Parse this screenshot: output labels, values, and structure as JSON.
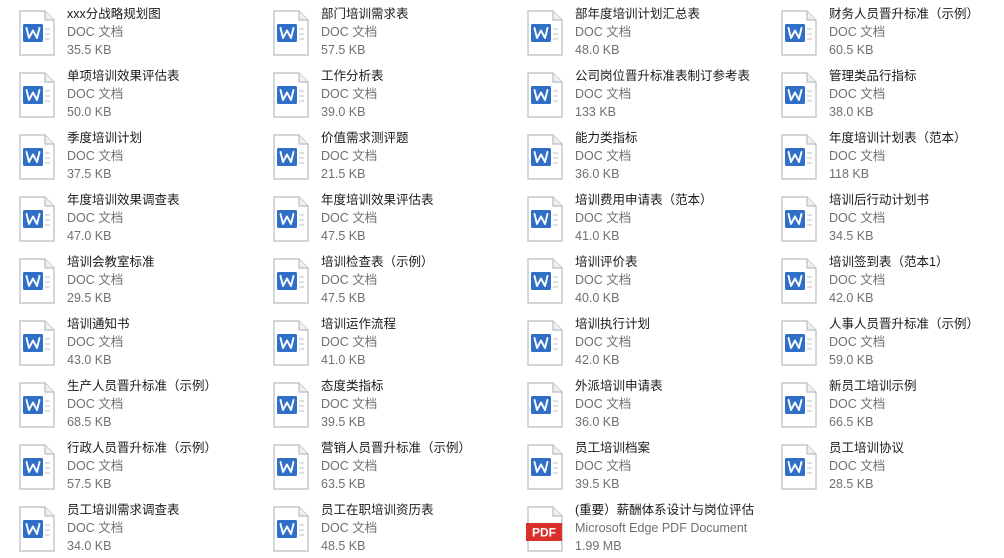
{
  "files": [
    {
      "name": "xxx分战略规划图",
      "type": "DOC 文档",
      "size": "35.5 KB",
      "icon": "word-doc-icon"
    },
    {
      "name": "部门培训需求表",
      "type": "DOC 文档",
      "size": "57.5 KB",
      "icon": "word-doc-icon"
    },
    {
      "name": "部年度培训计划汇总表",
      "type": "DOC 文档",
      "size": "48.0 KB",
      "icon": "word-doc-icon"
    },
    {
      "name": "财务人员晋升标准（示例）",
      "type": "DOC 文档",
      "size": "60.5 KB",
      "icon": "word-doc-icon"
    },
    {
      "name": "单项培训效果评估表",
      "type": "DOC 文档",
      "size": "50.0 KB",
      "icon": "word-doc-icon"
    },
    {
      "name": "工作分析表",
      "type": "DOC 文档",
      "size": "39.0 KB",
      "icon": "word-doc-icon"
    },
    {
      "name": "公司岗位晋升标准表制订参考表",
      "type": "DOC 文档",
      "size": "133 KB",
      "icon": "word-doc-icon"
    },
    {
      "name": "管理类品行指标",
      "type": "DOC 文档",
      "size": "38.0 KB",
      "icon": "word-doc-icon"
    },
    {
      "name": "季度培训计划",
      "type": "DOC 文档",
      "size": "37.5 KB",
      "icon": "word-doc-icon"
    },
    {
      "name": "价值需求测评题",
      "type": "DOC 文档",
      "size": "21.5 KB",
      "icon": "word-doc-icon"
    },
    {
      "name": "能力类指标",
      "type": "DOC 文档",
      "size": "36.0 KB",
      "icon": "word-doc-icon"
    },
    {
      "name": "年度培训计划表（范本）",
      "type": "DOC 文档",
      "size": "118 KB",
      "icon": "word-doc-icon"
    },
    {
      "name": "年度培训效果调查表",
      "type": "DOC 文档",
      "size": "47.0 KB",
      "icon": "word-doc-icon"
    },
    {
      "name": "年度培训效果评估表",
      "type": "DOC 文档",
      "size": "47.5 KB",
      "icon": "word-doc-icon"
    },
    {
      "name": "培训费用申请表（范本）",
      "type": "DOC 文档",
      "size": "41.0 KB",
      "icon": "word-doc-icon"
    },
    {
      "name": "培训后行动计划书",
      "type": "DOC 文档",
      "size": "34.5 KB",
      "icon": "word-doc-icon"
    },
    {
      "name": "培训会教室标准",
      "type": "DOC 文档",
      "size": "29.5 KB",
      "icon": "word-doc-icon"
    },
    {
      "name": "培训检查表（示例）",
      "type": "DOC 文档",
      "size": "47.5 KB",
      "icon": "word-doc-icon"
    },
    {
      "name": "培训评价表",
      "type": "DOC 文档",
      "size": "40.0 KB",
      "icon": "word-doc-icon"
    },
    {
      "name": "培训签到表（范本1）",
      "type": "DOC 文档",
      "size": "42.0 KB",
      "icon": "word-doc-icon"
    },
    {
      "name": "培训通知书",
      "type": "DOC 文档",
      "size": "43.0 KB",
      "icon": "word-doc-icon"
    },
    {
      "name": "培训运作流程",
      "type": "DOC 文档",
      "size": "41.0 KB",
      "icon": "word-doc-icon"
    },
    {
      "name": "培训执行计划",
      "type": "DOC 文档",
      "size": "42.0 KB",
      "icon": "word-doc-icon"
    },
    {
      "name": "人事人员晋升标准（示例）",
      "type": "DOC 文档",
      "size": "59.0 KB",
      "icon": "word-doc-icon"
    },
    {
      "name": "生产人员晋升标准（示例）",
      "type": "DOC 文档",
      "size": "68.5 KB",
      "icon": "word-doc-icon"
    },
    {
      "name": "态度类指标",
      "type": "DOC 文档",
      "size": "39.5 KB",
      "icon": "word-doc-icon"
    },
    {
      "name": "外派培训申请表",
      "type": "DOC 文档",
      "size": "36.0 KB",
      "icon": "word-doc-icon"
    },
    {
      "name": "新员工培训示例",
      "type": "DOC 文档",
      "size": "66.5 KB",
      "icon": "word-doc-icon"
    },
    {
      "name": "行政人员晋升标准（示例）",
      "type": "DOC 文档",
      "size": "57.5 KB",
      "icon": "word-doc-icon"
    },
    {
      "name": "营销人员晋升标准（示例）",
      "type": "DOC 文档",
      "size": "63.5 KB",
      "icon": "word-doc-icon"
    },
    {
      "name": "员工培训档案",
      "type": "DOC 文档",
      "size": "39.5 KB",
      "icon": "word-doc-icon"
    },
    {
      "name": "员工培训协议",
      "type": "DOC 文档",
      "size": "28.5 KB",
      "icon": "word-doc-icon"
    },
    {
      "name": "员工培训需求调查表",
      "type": "DOC 文档",
      "size": "34.0 KB",
      "icon": "word-doc-icon"
    },
    {
      "name": "员工在职培训资历表",
      "type": "DOC 文档",
      "size": "48.5 KB",
      "icon": "word-doc-icon"
    },
    {
      "name": "(重要）薪酬体系设计与岗位评估",
      "type": "Microsoft Edge PDF Document",
      "size": "1.99 MB",
      "icon": "pdf-icon",
      "badge": "PDF"
    }
  ],
  "colors": {
    "word_blue": "#2f6fc7",
    "pdf_red": "#d9302c"
  }
}
